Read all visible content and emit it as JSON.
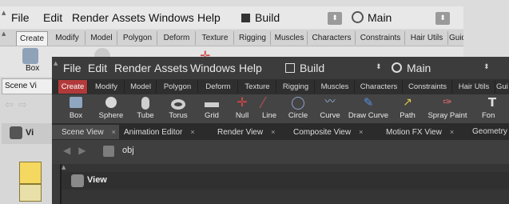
{
  "back": {
    "menu": [
      "File",
      "Edit",
      "Render",
      "Assets",
      "Windows",
      "Help"
    ],
    "desktop": "Build",
    "context": "Main",
    "shelf_tabs": [
      "Create",
      "Modify",
      "Model",
      "Polygon",
      "Deform",
      "Texture",
      "Rigging",
      "Muscles",
      "Characters",
      "Constraints",
      "Hair Utils",
      "Guid"
    ],
    "tool_label": "Box",
    "pane_tab": "Scene Vi",
    "network_label": "Vi"
  },
  "front": {
    "menu": [
      "File",
      "Edit",
      "Render",
      "Assets",
      "Windows",
      "Help"
    ],
    "desktop": "Build",
    "context": "Main",
    "shelf_tabs": [
      "Create",
      "Modify",
      "Model",
      "Polygon",
      "Deform",
      "Texture",
      "Rigging",
      "Muscles",
      "Characters",
      "Constraints",
      "Hair Utils",
      "Gui"
    ],
    "tools": [
      "Box",
      "Sphere",
      "Tube",
      "Torus",
      "Grid",
      "Null",
      "Line",
      "Circle",
      "Curve",
      "Draw Curve",
      "Path",
      "Spray Paint",
      "Fon"
    ],
    "pane_tabs": [
      "Scene View",
      "Animation Editor",
      "Render View",
      "Composite View",
      "Motion FX View",
      "Geometry Spre"
    ],
    "path": "obj",
    "viewer_label": "View"
  },
  "colors": {
    "accent_active_tab": "#b23a3a",
    "dark_bg": "#3a3a3a",
    "light_bg": "#dcdcdc"
  }
}
